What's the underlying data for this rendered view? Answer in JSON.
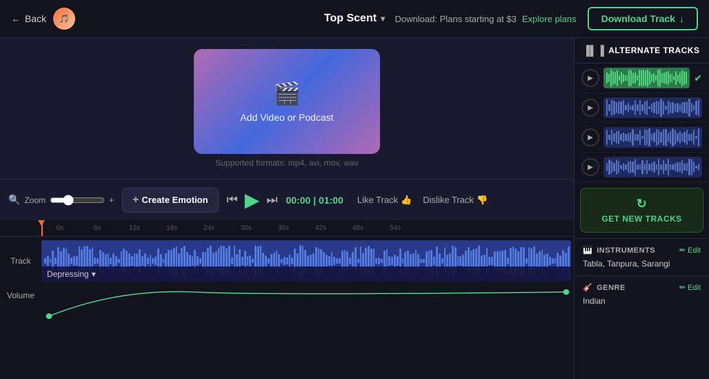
{
  "header": {
    "back_label": "Back",
    "logo_icon": "🎵",
    "top_scent_label": "Top Scent",
    "download_info": "Download: Plans starting at $3",
    "explore_label": "Explore plans",
    "download_btn_label": "Download Track"
  },
  "video": {
    "add_label": "Add Video or Podcast",
    "formats": "Supported formats: mp4, avi, mov, wav"
  },
  "controls": {
    "zoom_label": "Zoom",
    "create_emotion_label": "Create Emotion",
    "time_current": "00:00",
    "time_total": "01:00",
    "like_label": "Like Track",
    "dislike_label": "Dislike Track"
  },
  "timeline": {
    "ruler_marks": [
      "0s",
      "6s",
      "12s",
      "18s",
      "24s",
      "30s",
      "36s",
      "42s",
      "48s",
      "54s"
    ],
    "track_label": "Track",
    "volume_label": "Volume",
    "emotion_tag": "Depressing"
  },
  "right_panel": {
    "alternate_tracks_header": "ALTERNATE TRACKS",
    "tracks": [
      {
        "id": 1,
        "selected": true
      },
      {
        "id": 2,
        "selected": false
      },
      {
        "id": 3,
        "selected": false
      },
      {
        "id": 4,
        "selected": false
      }
    ],
    "get_new_tracks_label": "GET NEW TRACKS",
    "instruments_label": "INSTRUMENTS",
    "instruments_edit_label": "Edit",
    "instruments_value": "Tabla, Tanpura, Sarangi",
    "genre_label": "GENRE",
    "genre_edit_label": "Edit",
    "genre_value": "Indian"
  },
  "colors": {
    "accent_green": "#4dd68c",
    "accent_orange": "#ff6b35",
    "track_bg": "#2a3a8a",
    "selected_track_bg": "#2a7a4a"
  }
}
